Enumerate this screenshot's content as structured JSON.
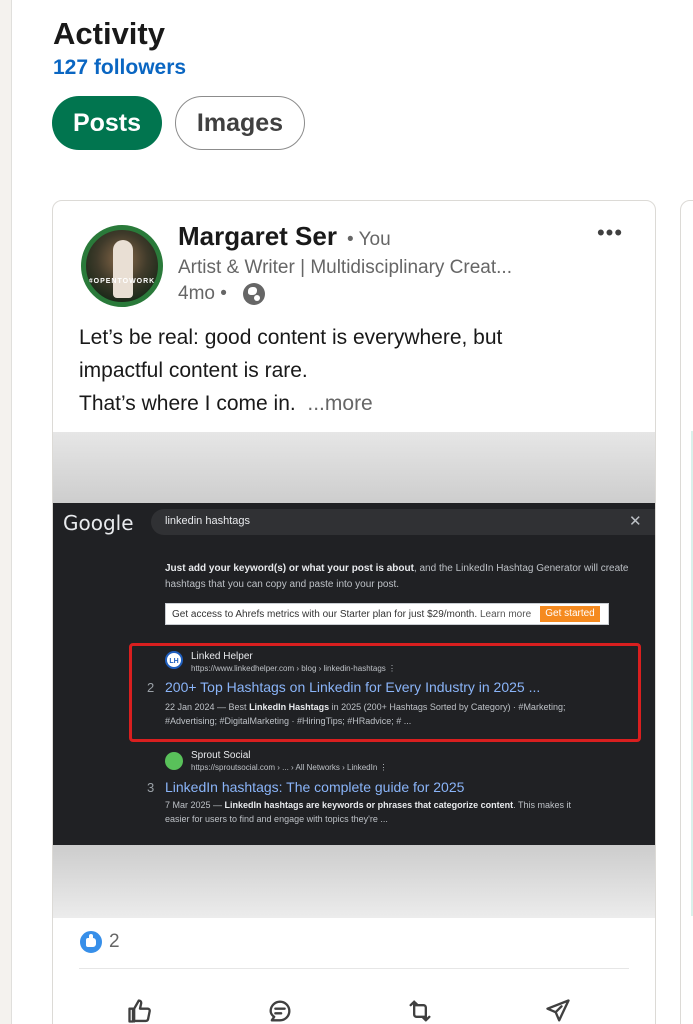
{
  "activity": {
    "title": "Activity",
    "followers": "127 followers",
    "tabs": [
      {
        "label": "Posts",
        "active": true
      },
      {
        "label": "Images",
        "active": false
      }
    ]
  },
  "post": {
    "author": {
      "name": "Margaret Ser",
      "you_tag": "• You",
      "headline": "Artist & Writer | Multidisciplinary Creat...",
      "time": "4mo •",
      "avatar_ring_text": "#OPENTOWORK"
    },
    "text_lines": [
      "Let’s be real: good content is everywhere, but",
      "impactful content is rare.",
      "That’s where I come in."
    ],
    "more_label": "...more",
    "reaction_count": "2",
    "actions": [
      "like-icon",
      "comment-icon",
      "repost-icon",
      "send-icon"
    ]
  },
  "screenshot": {
    "logo": "Google",
    "query": "linkedin hashtags",
    "clear": "✕",
    "snippet_line1_bold": "Just add your keyword(s) or what your post is about",
    "snippet_line1_rest": ", and the LinkedIn Hashtag Generator will create",
    "snippet_line2": "hashtags that you can copy and paste into your post.",
    "ahrefs_text": "Get access to Ahrefs metrics with our Starter plan for just $29/month.",
    "ahrefs_learn": "Learn more",
    "ahrefs_cta": "Get started",
    "results": [
      {
        "favicon": "LH",
        "site": "Linked Helper",
        "url": "https://www.linkedhelper.com › blog › linkedin-hashtags  ⋮",
        "num": "2",
        "title": "200+ Top Hashtags on Linkedin for Every Industry in 2025 ...",
        "desc1_plain": "22 Jan 2024 — Best ",
        "desc1_bold": "LinkedIn Hashtags",
        "desc1_rest": " in 2025 (200+ Hashtags Sorted by Category) · #Marketing;",
        "desc2": "#Advertising; #DigitalMarketing · #HiringTips; #HRadvice; # ..."
      },
      {
        "favicon": "",
        "site": "Sprout Social",
        "url": "https://sproutsocial.com › ... › All Networks › LinkedIn  ⋮",
        "num": "3",
        "title": "LinkedIn hashtags: The complete guide for 2025",
        "desc1_plain": "7 Mar 2025 — ",
        "desc1_bold": "LinkedIn hashtags are keywords or phrases that categorize content",
        "desc1_rest": ". This makes it",
        "desc2": "easier for users to find and engage with topics they're ..."
      }
    ]
  },
  "colors": {
    "brand_green": "#01754f",
    "link_blue": "#0a66c2",
    "highlight_red": "#d91f1f"
  }
}
